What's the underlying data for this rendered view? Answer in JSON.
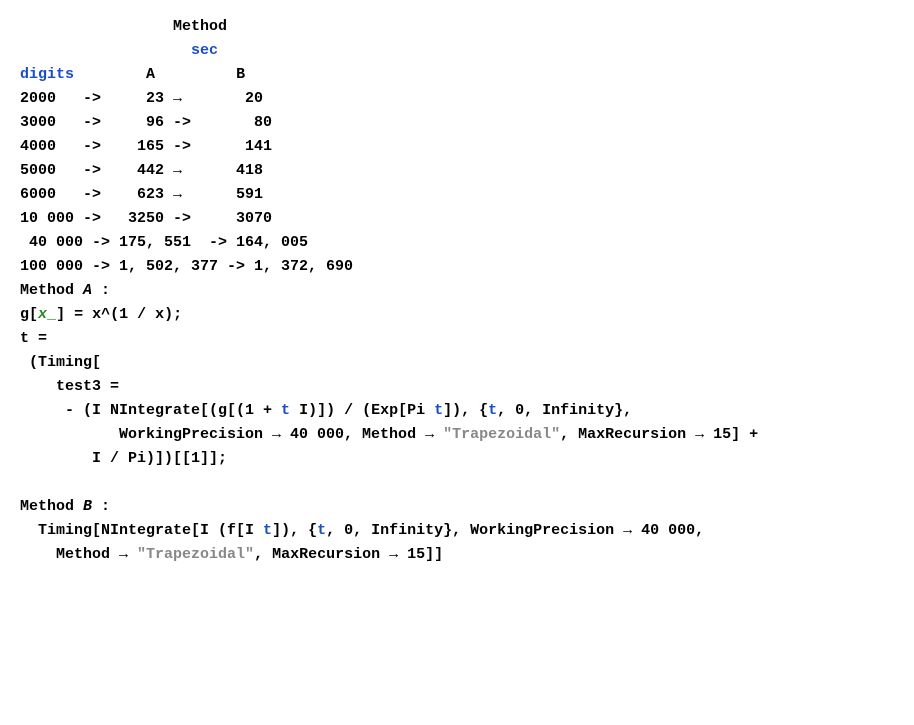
{
  "header": {
    "method_label": "Method",
    "sec_label": "sec",
    "digits_label": "digits",
    "col_a": "A",
    "col_b": "B"
  },
  "table_rows": [
    {
      "d": "2000",
      "a": "23",
      "b": "20",
      "arr1": "->",
      "arr2": "→"
    },
    {
      "d": "3000",
      "a": "96",
      "b": "80",
      "arr1": "->",
      "arr2": "->"
    },
    {
      "d": "4000",
      "a": "165",
      "b": "141",
      "arr1": "->",
      "arr2": "->"
    },
    {
      "d": "5000",
      "a": "442",
      "b": "418",
      "arr1": "->",
      "arr2": "→"
    },
    {
      "d": "6000",
      "a": "623",
      "b": "591",
      "arr1": "->",
      "arr2": "→"
    },
    {
      "d": "10 000",
      "a": "3250",
      "b": "3070",
      "arr1": "->",
      "arr2": "->"
    }
  ],
  "wide_rows": [
    {
      "text": " 40 000 -> 175, 551  -> 164, 005"
    },
    {
      "text": "100 000 -> 1, 502, 377 -> 1, 372, 690"
    }
  ],
  "method_a": {
    "label_prefix": "Method ",
    "label_letter": "A",
    "label_suffix": " :",
    "gdef_g": "g",
    "gdef_lb": "[",
    "gdef_x": "x",
    "gdef_us": "_",
    "gdef_rb": "] ",
    "gdef_eq": "= ",
    "gdef_rhs_x": "x",
    "gdef_rhs_pow": "^(1 / ",
    "gdef_rhs_x2": "x",
    "gdef_rhs_end": ");",
    "t_eq": "t =",
    "timing_open": " (Timing[",
    "test3": "    test3 =",
    "nint_line_p1": "     - (I NIntegrate[(g[(1 + ",
    "nint_line_t": "t",
    "nint_line_p2": " I)]) / (Exp[Pi ",
    "nint_line_t2": "t",
    "nint_line_p3": "]), {",
    "nint_line_t3": "t",
    "nint_line_p4": ", 0, Infinity},",
    "wp_line_p1": "           WorkingPrecision → 40 000, Method → ",
    "wp_line_str": "\"Trapezoidal\"",
    "wp_line_p2": ", MaxRecursion → 15] +",
    "ipi_line": "        I / Pi)])[[1]];"
  },
  "method_b": {
    "label_prefix": "Method ",
    "label_letter": "B",
    "label_suffix": " :",
    "line1_p1": "  Timing[NIntegrate[I (f[I ",
    "line1_t": "t",
    "line1_p2": "]), {",
    "line1_t2": "t",
    "line1_p3": ", 0, Infinity}, WorkingPrecision → 40 000,",
    "line2_p1": "    Method → ",
    "line2_str": "\"Trapezoidal\"",
    "line2_p2": ", MaxRecursion → 15]]"
  }
}
